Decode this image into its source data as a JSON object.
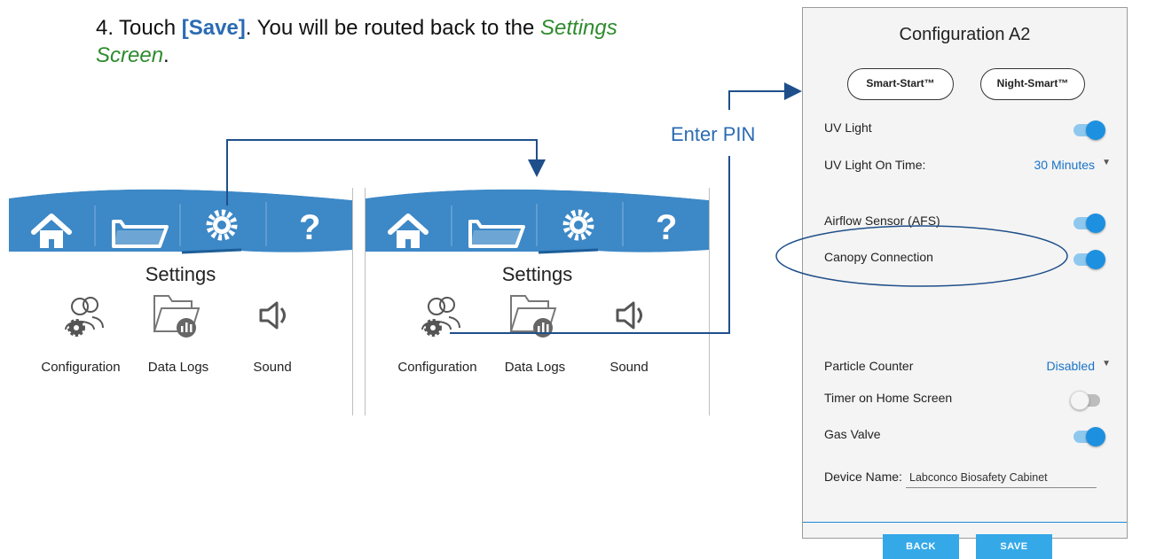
{
  "instruction": {
    "number": "4.",
    "prefix": "Touch ",
    "save": "[Save]",
    "middle": ". You will be routed back to the ",
    "link_line1": "Settings",
    "link_line2": "Screen",
    "suffix": "."
  },
  "annotation": {
    "enter_pin": "Enter PIN"
  },
  "settings_screen": {
    "title": "Settings",
    "nav_icons": [
      "home-icon",
      "folder-icon",
      "gear-icon",
      "help-icon"
    ],
    "tiles": [
      {
        "label": "Configuration",
        "icon": "users-gear-icon"
      },
      {
        "label": "Data Logs",
        "icon": "folder-chart-icon"
      },
      {
        "label": "Sound",
        "icon": "speaker-icon"
      }
    ]
  },
  "config_screen": {
    "title": "Configuration A2",
    "buttons": {
      "smart_start": "Smart-Start™",
      "night_smart": "Night-Smart™"
    },
    "uv_light": {
      "label": "UV Light",
      "state": "on"
    },
    "uv_light_on_time": {
      "label": "UV Light On Time:",
      "value": "30 Minutes"
    },
    "airflow_sensor": {
      "label": "Airflow Sensor (AFS)",
      "state": "on"
    },
    "canopy_connection": {
      "label": "Canopy Connection",
      "state": "on"
    },
    "particle_counter": {
      "label": "Particle Counter",
      "value": "Disabled"
    },
    "timer_home": {
      "label": "Timer on Home Screen",
      "state": "off"
    },
    "gas_valve": {
      "label": "Gas Valve",
      "state": "on"
    },
    "device_name": {
      "label": "Device Name:",
      "value": "Labconco Biosafety Cabinet"
    },
    "actions": {
      "back": "BACK",
      "save": "SAVE"
    }
  },
  "colors": {
    "accent": "#2b6bb3",
    "nav_blue": "#3d88c6",
    "toggle_on": "#1e90e0",
    "link_green": "#2e8b2e"
  }
}
